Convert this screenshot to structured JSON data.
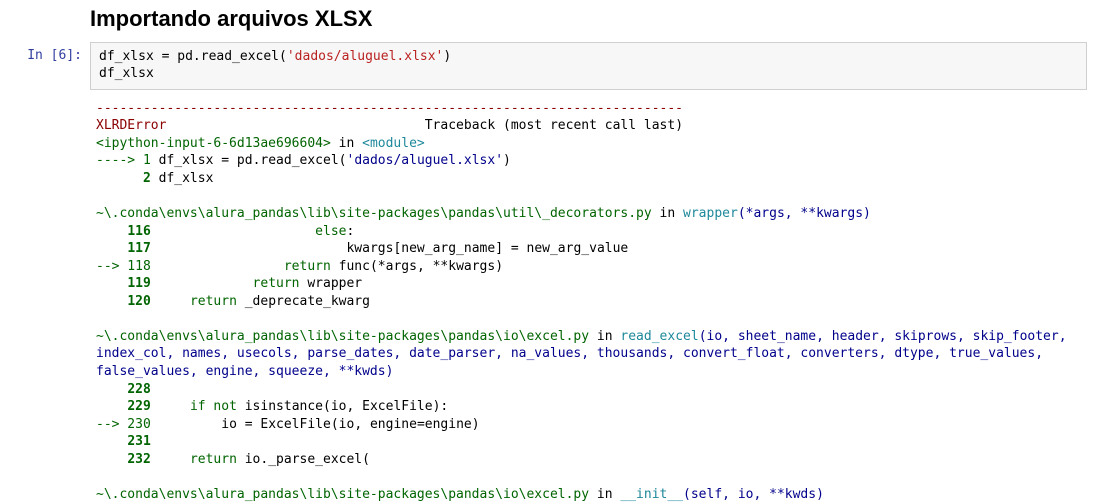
{
  "heading": "Importando arquivos XLSX",
  "cell": {
    "prompt": "In [6]:",
    "code_line1_pre": "df_xlsx = pd.read_excel(",
    "code_line1_str": "'dados/aluguel.xlsx'",
    "code_line1_post": ")",
    "code_line2": "df_xlsx"
  },
  "tb": {
    "dashes": "---------------------------------------------------------------------------",
    "err_name": "XLRDError",
    "err_pad": "                                 ",
    "err_tail": "Traceback (most recent call last)",
    "frame0_loc": "<ipython-input-6-6d13ae696604>",
    "in": " in ",
    "frame0_fn": "<module>",
    "frame0_args": "",
    "f0_l1_arrow": "----> 1",
    "f0_l1_code_a": " df_xlsx ",
    "eq": "=",
    "f0_l1_code_b": " pd",
    "dot": ".",
    "f0_l1_code_c": "read_excel",
    "lpar": "(",
    "f0_l1_str": "'dados/aluguel.xlsx'",
    "rpar": ")",
    "f0_l2_num": "      2",
    "f0_l2_code": " df_xlsx",
    "frame1_loc": "~\\.conda\\envs\\alura_pandas\\lib\\site-packages\\pandas\\util\\_decorators.py",
    "frame1_fn": "wrapper",
    "frame1_args": "(*args, **kwargs)",
    "f1_l116_num": "    116",
    "f1_l116_code_pad": "                     ",
    "f1_l116_kw": "else",
    "colon": ":",
    "f1_l117_num": "    117",
    "f1_l117_code_a": "                         kwargs",
    "lbrk": "[",
    "f1_l117_code_b": "new_arg_name",
    "rbrk": "]",
    "sp": " ",
    "f1_l117_code_c": " new_arg_value",
    "f1_l118_arrow": "--> 118",
    "f1_l118_pad": "                 ",
    "f1_l118_kw": "return",
    "f1_l118_code": " func",
    "star": "*",
    "f1_l118_args": "args",
    "comma": ",",
    "dstar": "**",
    "f1_l118_kwargs": "kwargs",
    "f1_l119_num": "    119",
    "f1_l119_pad": "             ",
    "f1_l119_code": " wrapper",
    "f1_l120_num": "    120",
    "f1_l120_pad": "     ",
    "f1_l120_code": " _deprecate_kwarg",
    "frame2_loc": "~\\.conda\\envs\\alura_pandas\\lib\\site-packages\\pandas\\io\\excel.py",
    "frame2_fn": "read_excel",
    "frame2_args": "(io, sheet_name, header, skiprows, skip_footer, index_col, names, usecols, parse_dates, date_parser, na_values, thousands, convert_float, converters, dtype, true_values, false_values, engine, squeeze, **kwds)",
    "f2_l228_num": "    228",
    "f2_l229_num": "    229",
    "f2_l229_pad": "     ",
    "if": "if",
    "not": "not",
    "f2_l229_code_a": " isinstance",
    "f2_l229_code_b": "io",
    "f2_l229_code_c": " ExcelFile",
    "f2_l230_arrow": "--> 230",
    "f2_l230_pad": "         io ",
    "f2_l230_code_a": " ExcelFile",
    "f2_l230_code_b": "io",
    "f2_l230_code_c": " engine",
    "f2_l230_code_d": "engine",
    "f2_l231_num": "    231",
    "f2_l232_num": "    232",
    "f2_l232_pad": "     ",
    "f2_l232_code_a": " io",
    "f2_l232_code_b": "_parse_excel",
    "frame3_loc": "~\\.conda\\envs\\alura_pandas\\lib\\site-packages\\pandas\\io\\excel.py",
    "frame3_fn": "__init__",
    "frame3_args": "(self, io, **kwds)"
  }
}
